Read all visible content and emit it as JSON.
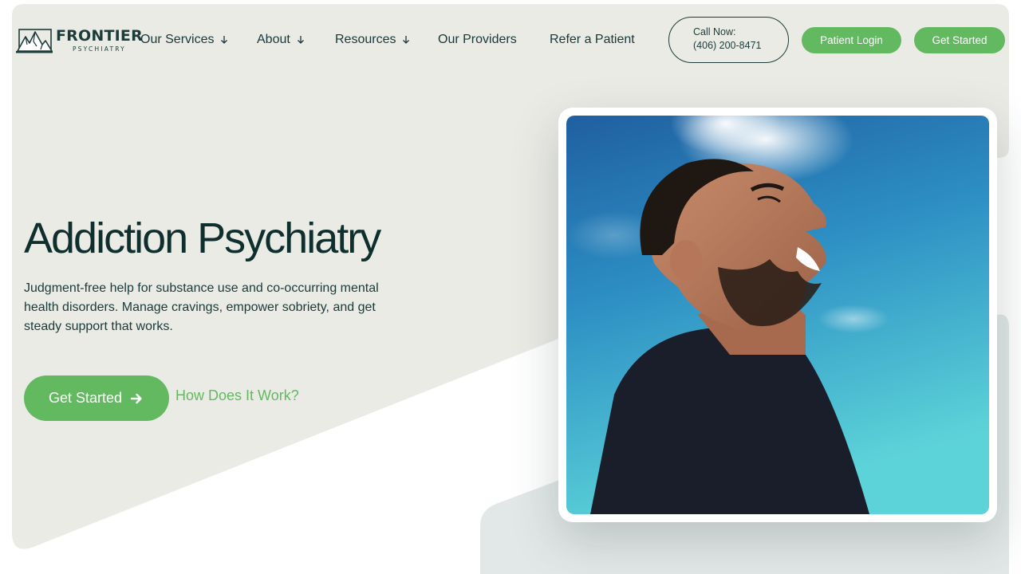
{
  "brand": {
    "name": "FRONTIER",
    "tagline": "PSYCHIATRY"
  },
  "nav": {
    "items": [
      {
        "label": "Our Services",
        "has_dropdown": true
      },
      {
        "label": "About",
        "has_dropdown": true
      },
      {
        "label": "Resources",
        "has_dropdown": true
      },
      {
        "label": "Our Providers",
        "has_dropdown": false
      },
      {
        "label": "Refer a Patient",
        "has_dropdown": false
      }
    ]
  },
  "header": {
    "call_label": "Call Now:",
    "call_number": "(406) 200-8471",
    "login_label": "Patient Login",
    "get_started_label": "Get Started"
  },
  "hero": {
    "title": "Addiction Psychiatry",
    "description": "Judgment-free help for substance use and co-occurring mental health disorders. Manage cravings, empower sobriety, and get steady support that works.",
    "cta_label": "Get Started",
    "secondary_link": "How Does It Work?",
    "image_icon": "man-laughing-photo"
  },
  "colors": {
    "accent_green": "#62b960",
    "dark_teal": "#0f2e2e",
    "panel_bg": "#ebebe6",
    "secondary_panel": "#e2e8e8"
  }
}
